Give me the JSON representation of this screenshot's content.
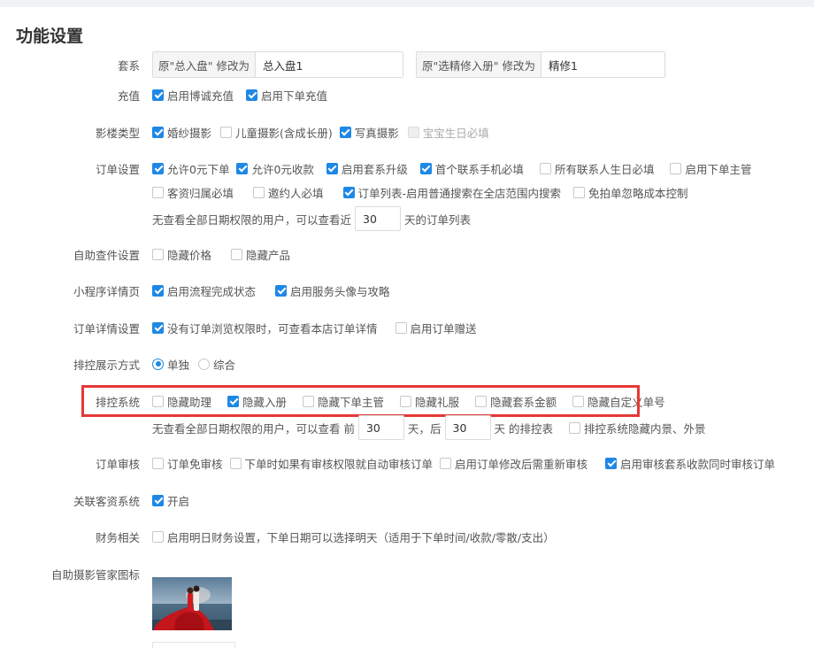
{
  "page_title": "功能设置",
  "package": {
    "label": "套系",
    "field1": {
      "addon": "原\"总入盘\" 修改为",
      "value": "总入盘1"
    },
    "field2": {
      "addon": "原\"选精修入册\" 修改为",
      "value": "精修1"
    }
  },
  "recharge": {
    "label": "充值",
    "items": [
      {
        "text": "启用博诚充值",
        "checked": true
      },
      {
        "text": "启用下单充值",
        "checked": true
      }
    ]
  },
  "studio_type": {
    "label": "影楼类型",
    "items": [
      {
        "text": "婚纱摄影",
        "checked": true
      },
      {
        "text": "儿童摄影(含成长册)",
        "checked": false
      },
      {
        "text": "写真摄影",
        "checked": true
      },
      {
        "text": "宝宝生日必填",
        "checked": false,
        "disabled": true
      }
    ]
  },
  "order_settings": {
    "label": "订单设置",
    "row1": [
      {
        "text": "允许0元下单",
        "checked": true
      },
      {
        "text": "允许0元收款",
        "checked": true
      },
      {
        "text": "启用套系升级",
        "checked": true
      },
      {
        "text": "首个联系手机必填",
        "checked": true
      },
      {
        "text": "所有联系人生日必填",
        "checked": false
      },
      {
        "text": "启用下单主管",
        "checked": false
      }
    ],
    "row2": [
      {
        "text": "客资归属必填",
        "checked": false
      },
      {
        "text": "邀约人必填",
        "checked": false
      },
      {
        "text": "订单列表-启用普通搜索在全店范围内搜索",
        "checked": true
      },
      {
        "text": "免拍单忽略成本控制",
        "checked": false
      }
    ],
    "limit_prefix": "无查看全部日期权限的用户，可以查看近",
    "limit_value": "30",
    "limit_suffix": "天的订单列表"
  },
  "self_query": {
    "label": "自助查件设置",
    "items": [
      {
        "text": "隐藏价格",
        "checked": false
      },
      {
        "text": "隐藏产品",
        "checked": false
      }
    ]
  },
  "mini_program": {
    "label": "小程序详情页",
    "items": [
      {
        "text": "启用流程完成状态",
        "checked": true
      },
      {
        "text": "启用服务头像与攻略",
        "checked": true
      }
    ]
  },
  "order_detail": {
    "label": "订单详情设置",
    "items": [
      {
        "text": "没有订单浏览权限时，可查看本店订单详情",
        "checked": true
      },
      {
        "text": "启用订单赠送",
        "checked": false
      }
    ]
  },
  "schedule_display": {
    "label": "排控展示方式",
    "options": [
      {
        "text": "单独",
        "selected": true
      },
      {
        "text": "综合",
        "selected": false
      }
    ]
  },
  "schedule_system": {
    "label": "排控系统",
    "items": [
      {
        "text": "隐藏助理",
        "checked": false
      },
      {
        "text": "隐藏入册",
        "checked": true
      },
      {
        "text": "隐藏下单主管",
        "checked": false
      },
      {
        "text": "隐藏礼服",
        "checked": false
      },
      {
        "text": "隐藏套系金额",
        "checked": false
      },
      {
        "text": "隐藏自定义单号",
        "checked": false
      }
    ],
    "range_prefix": "无查看全部日期权限的用户，可以查看 前",
    "before_value": "30",
    "range_mid": "天，后",
    "after_value": "30",
    "range_suffix": "天 的排控表",
    "hide_scene": {
      "text": "排控系统隐藏内景、外景",
      "checked": false
    }
  },
  "order_review": {
    "label": "订单审核",
    "items": [
      {
        "text": "订单免审核",
        "checked": false
      },
      {
        "text": "下单时如果有审核权限就自动审核订单",
        "checked": false
      },
      {
        "text": "启用订单修改后需重新审核",
        "checked": false
      },
      {
        "text": "启用审核套系收款同时审核订单",
        "checked": true
      }
    ]
  },
  "linked_crm": {
    "label": "关联客资系统",
    "items": [
      {
        "text": "开启",
        "checked": true
      }
    ]
  },
  "finance": {
    "label": "财务相关",
    "items": [
      {
        "text": "启用明日财务设置，下单日期可以选择明天（适用于下单时间/收款/零散/支出）",
        "checked": false
      }
    ]
  },
  "self_photo_icon": {
    "label": "自助摄影管家图标"
  },
  "colors": {
    "accent": "#1e88e5",
    "highlight": "#e53935"
  }
}
